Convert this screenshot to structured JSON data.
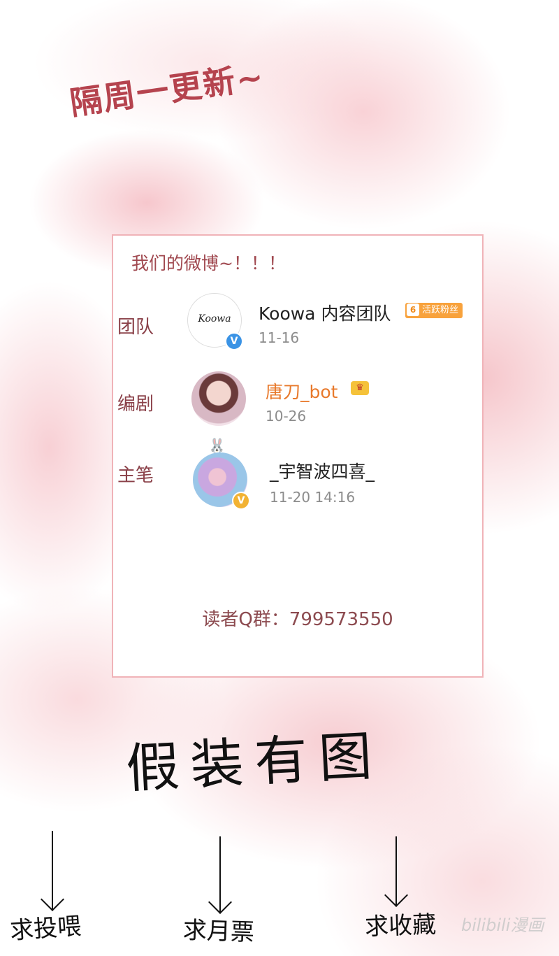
{
  "title": "隔周一更新~",
  "card": {
    "heading": "我们的微博~！！！",
    "entries": [
      {
        "role": "团队",
        "avatar_text": "Koowa",
        "name": "Koowa 内容团队",
        "fan_level": "6",
        "fan_tag": "活跃粉丝",
        "date": "11-16",
        "verify_badge": "V",
        "verify_color": "#3a93e5"
      },
      {
        "role": "编剧",
        "name": "唐刀_bot",
        "name_color": "#e8792b",
        "date": "10-26",
        "crown_icon": "crown-icon"
      },
      {
        "role": "主笔",
        "name": "_宇智波四喜_",
        "date": "11-20 14:16",
        "verify_badge": "V",
        "verify_color": "#f2b233",
        "bunny_icon": "bunny-icon"
      }
    ],
    "group_line": "读者Q群：799573550"
  },
  "handwriting": {
    "big": "假装有图",
    "items": [
      "求投喂",
      "求月票",
      "求收藏"
    ]
  },
  "watermark": "bilibili漫画",
  "colors": {
    "accent": "#b5434e",
    "card_border": "#f0b3b8",
    "background_pink": "#f6c4ca"
  }
}
